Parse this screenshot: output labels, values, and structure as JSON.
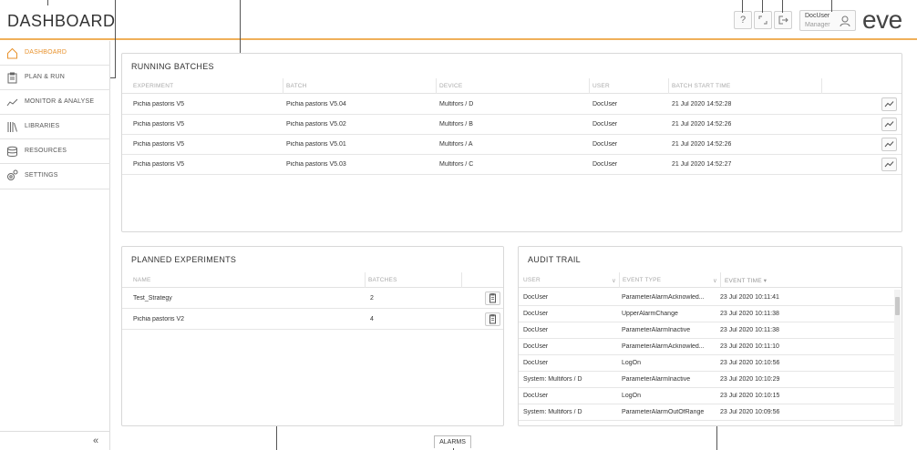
{
  "header": {
    "title": "DASHBOARD",
    "help_label": "?",
    "user_name": "DocUser",
    "user_role": "Manager",
    "logo": "eve"
  },
  "sidebar": {
    "items": [
      {
        "label": "DASHBOARD",
        "icon": "home-icon"
      },
      {
        "label": "PLAN & RUN",
        "icon": "clipboard-icon"
      },
      {
        "label": "MONITOR & ANALYSE",
        "icon": "trend-icon"
      },
      {
        "label": "LIBRARIES",
        "icon": "books-icon"
      },
      {
        "label": "RESOURCES",
        "icon": "database-icon"
      },
      {
        "label": "SETTINGS",
        "icon": "gear-icon"
      }
    ],
    "collapse_label": "«"
  },
  "running_batches": {
    "title": "RUNNING BATCHES",
    "columns": [
      "EXPERIMENT",
      "BATCH",
      "DEVICE",
      "USER",
      "BATCH START TIME"
    ],
    "rows": [
      [
        "Pichia pastoris V5",
        "Pichia pastoris V5.04",
        "Multifors / D",
        "DocUser",
        "21 Jul 2020 14:52:28"
      ],
      [
        "Pichia pastoris V5",
        "Pichia pastoris V5.02",
        "Multifors / B",
        "DocUser",
        "21 Jul 2020 14:52:26"
      ],
      [
        "Pichia pastoris V5",
        "Pichia pastoris V5.01",
        "Multifors / A",
        "DocUser",
        "21 Jul 2020 14:52:26"
      ],
      [
        "Pichia pastoris V5",
        "Pichia pastoris V5.03",
        "Multifors / C",
        "DocUser",
        "21 Jul 2020 14:52:27"
      ]
    ]
  },
  "planned_experiments": {
    "title": "PLANNED EXPERIMENTS",
    "columns": [
      "NAME",
      "BATCHES"
    ],
    "rows": [
      [
        "Test_Strategy",
        "2"
      ],
      [
        "Pichia pastoris V2",
        "4"
      ]
    ]
  },
  "audit_trail": {
    "title": "AUDIT TRAIL",
    "columns": [
      "USER",
      "EVENT TYPE",
      "EVENT TIME ▾"
    ],
    "rows": [
      [
        "DocUser",
        "ParameterAlarmAcknowled...",
        "23 Jul 2020 10:11:41"
      ],
      [
        "DocUser",
        "UpperAlarmChange",
        "23 Jul 2020 10:11:38"
      ],
      [
        "DocUser",
        "ParameterAlarmInactive",
        "23 Jul 2020 10:11:38"
      ],
      [
        "DocUser",
        "ParameterAlarmAcknowled...",
        "23 Jul 2020 10:11:10"
      ],
      [
        "DocUser",
        "LogOn",
        "23 Jul 2020 10:10:56"
      ],
      [
        "System: Multifors / D",
        "ParameterAlarmInactive",
        "23 Jul 2020 10:10:29"
      ],
      [
        "DocUser",
        "LogOn",
        "23 Jul 2020 10:10:15"
      ],
      [
        "System: Multifors / D",
        "ParameterAlarmOutOfRange",
        "23 Jul 2020 10:09:56"
      ]
    ]
  },
  "footer": {
    "alarms_label": "ALARMS"
  },
  "colors": {
    "accent": "#e8922c",
    "header_border": "#f0b05a"
  }
}
